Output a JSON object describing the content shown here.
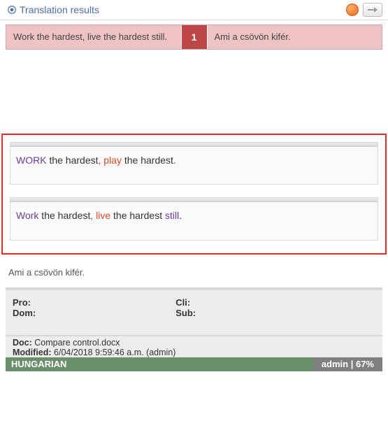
{
  "header": {
    "title": "Translation results"
  },
  "result": {
    "source": "Work the hardest, live the hardest still.",
    "number": "1",
    "target": "Ami a csövön kifér."
  },
  "segments": {
    "seg1": {
      "w1": "WORK",
      "w2": " the hardest",
      "c1": ", ",
      "w3": "play",
      "w4": " the hardest",
      "p1": "."
    },
    "seg2": {
      "w1": "Work",
      "w2": " the hardest",
      "c1": ", ",
      "w3": "live",
      "w4": " the hardest ",
      "w5": "still",
      "p1": "."
    }
  },
  "below_text": "Ami a csövön kifér.",
  "meta": {
    "pro_label": "Pro:",
    "cli_label": "Cli:",
    "dom_label": "Dom:",
    "sub_label": "Sub:"
  },
  "doc": {
    "doc_label": "Doc:",
    "doc_value": " Compare control.docx",
    "mod_label": "Modified:",
    "mod_value": " 6/04/2018 9:59:46 a.m. (admin)"
  },
  "status": {
    "lang": "HUNGARIAN",
    "user": "admin",
    "sep": " | ",
    "pct": "67%"
  }
}
